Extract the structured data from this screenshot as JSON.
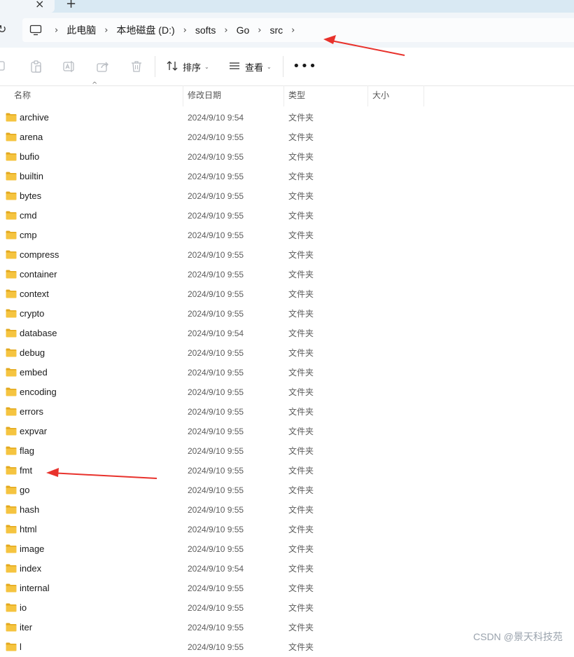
{
  "tabs": {
    "close_glyph": "×",
    "new_glyph": "+"
  },
  "nav": {
    "refresh_glyph": "↻",
    "breadcrumbs": [
      "此电脑",
      "本地磁盘 (D:)",
      "softs",
      "Go",
      "src"
    ],
    "separator": "›"
  },
  "toolbar": {
    "sort_label": "排序",
    "view_label": "查看",
    "more_glyph": "•••",
    "caret_glyph": "⌄"
  },
  "columns": {
    "name": "名称",
    "modified": "修改日期",
    "type": "类型",
    "size": "大小",
    "sort_indicator": "^"
  },
  "rows": [
    {
      "name": "archive",
      "date": "2024/9/10 9:54",
      "type": "文件夹"
    },
    {
      "name": "arena",
      "date": "2024/9/10 9:55",
      "type": "文件夹"
    },
    {
      "name": "bufio",
      "date": "2024/9/10 9:55",
      "type": "文件夹"
    },
    {
      "name": "builtin",
      "date": "2024/9/10 9:55",
      "type": "文件夹"
    },
    {
      "name": "bytes",
      "date": "2024/9/10 9:55",
      "type": "文件夹"
    },
    {
      "name": "cmd",
      "date": "2024/9/10 9:55",
      "type": "文件夹"
    },
    {
      "name": "cmp",
      "date": "2024/9/10 9:55",
      "type": "文件夹"
    },
    {
      "name": "compress",
      "date": "2024/9/10 9:55",
      "type": "文件夹"
    },
    {
      "name": "container",
      "date": "2024/9/10 9:55",
      "type": "文件夹"
    },
    {
      "name": "context",
      "date": "2024/9/10 9:55",
      "type": "文件夹"
    },
    {
      "name": "crypto",
      "date": "2024/9/10 9:55",
      "type": "文件夹"
    },
    {
      "name": "database",
      "date": "2024/9/10 9:54",
      "type": "文件夹"
    },
    {
      "name": "debug",
      "date": "2024/9/10 9:55",
      "type": "文件夹"
    },
    {
      "name": "embed",
      "date": "2024/9/10 9:55",
      "type": "文件夹"
    },
    {
      "name": "encoding",
      "date": "2024/9/10 9:55",
      "type": "文件夹"
    },
    {
      "name": "errors",
      "date": "2024/9/10 9:55",
      "type": "文件夹"
    },
    {
      "name": "expvar",
      "date": "2024/9/10 9:55",
      "type": "文件夹"
    },
    {
      "name": "flag",
      "date": "2024/9/10 9:55",
      "type": "文件夹"
    },
    {
      "name": "fmt",
      "date": "2024/9/10 9:55",
      "type": "文件夹"
    },
    {
      "name": "go",
      "date": "2024/9/10 9:55",
      "type": "文件夹"
    },
    {
      "name": "hash",
      "date": "2024/9/10 9:55",
      "type": "文件夹"
    },
    {
      "name": "html",
      "date": "2024/9/10 9:55",
      "type": "文件夹"
    },
    {
      "name": "image",
      "date": "2024/9/10 9:55",
      "type": "文件夹"
    },
    {
      "name": "index",
      "date": "2024/9/10 9:54",
      "type": "文件夹"
    },
    {
      "name": "internal",
      "date": "2024/9/10 9:55",
      "type": "文件夹"
    },
    {
      "name": "io",
      "date": "2024/9/10 9:55",
      "type": "文件夹"
    },
    {
      "name": "iter",
      "date": "2024/9/10 9:55",
      "type": "文件夹"
    },
    {
      "name": "l",
      "date": "2024/9/10 9:55",
      "type": "文件夹"
    }
  ],
  "watermark": "CSDN @景天科技苑",
  "colors": {
    "folder": "#f5c440",
    "folder_dark": "#e3a91e",
    "annotation_arrow": "#e8322c",
    "nav_bg": "#f1f5f9"
  }
}
